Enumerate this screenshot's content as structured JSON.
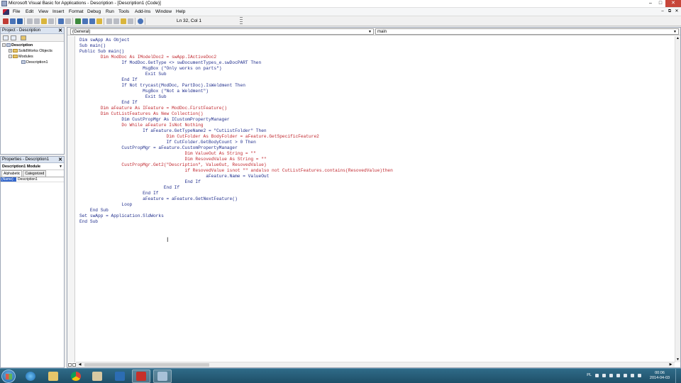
{
  "window": {
    "title": "Microsoft Visual Basic for Applications - Description - [Description1 (Code)]"
  },
  "menu": [
    "File",
    "Edit",
    "View",
    "Insert",
    "Format",
    "Debug",
    "Run",
    "Tools",
    "Add-Ins",
    "Window",
    "Help"
  ],
  "toolbar": {
    "status": "Ln 32, Col 1"
  },
  "project": {
    "title": "Project - Description",
    "tree": {
      "root": "Description",
      "folder1": "SolidWorks Objects",
      "folder2": "Modules",
      "module": "Description1"
    }
  },
  "properties": {
    "title": "Properties - Description1",
    "object": "Description1 Module",
    "tabs": [
      "Alphabetic",
      "Categorized"
    ],
    "name_key": "(Name)",
    "name_value": "Description1"
  },
  "code_window": {
    "object_combo": "(General)",
    "proc_combo": "main",
    "lines": [
      {
        "text": "Dim swApp As Object",
        "err": false
      },
      {
        "text": "Sub main()",
        "err": false
      },
      {
        "text": "Public Sub main()",
        "err": false
      },
      {
        "text": "        Dim ModDoc As IModelDoc2 = swApp.IActiveDoc2",
        "err": true
      },
      {
        "text": "                If ModDoc.GetType <> swDocumentTypes_e.swDocPART Then",
        "err": false
      },
      {
        "text": "                        MsgBox (\"Only works on parts\")",
        "err": false
      },
      {
        "text": "                         Exit Sub",
        "err": false
      },
      {
        "text": "                End If",
        "err": false
      },
      {
        "text": "                If Not trycast(ModDoc, PartDoc).IsWeldment Then",
        "err": false
      },
      {
        "text": "                        MsgBox (\"Not a Weldment\")",
        "err": false
      },
      {
        "text": "                         Exit Sub",
        "err": false
      },
      {
        "text": "                End If",
        "err": false
      },
      {
        "text": "        Dim aFeature As IFeature = ModDoc.FirstFeature()",
        "err": true
      },
      {
        "text": "        Dim CutListFeatures As New Collection()",
        "err": true
      },
      {
        "text": "                Dim CustPropMgr As ICustomPropertyManager",
        "err": false
      },
      {
        "text": "                Do While aFeature IsNot Nothing",
        "err": true
      },
      {
        "text": "                        If aFeature.GetTypeName2 = \"CutListFolder\" Then",
        "err": false
      },
      {
        "text": "                                 Dim CutFolder As BodyFolder = aFeature.GetSpecificFeature2",
        "err": true
      },
      {
        "text": "                                 If CutFolder.GetBodyCount > 0 Then",
        "err": false
      },
      {
        "text": "                CustPropMgr = aFeature.CustomPropertyManager",
        "err": false
      },
      {
        "text": "                                        Dim ValueOut As String = \"\"",
        "err": true
      },
      {
        "text": "                                        Dim ResovedValue As String = \"\"",
        "err": true
      },
      {
        "text": "                CustPropMgr.Get2(\"Description\", ValueOut, ResovedValue)",
        "err": true
      },
      {
        "text": "                                        if ResovedValue isnot \"\" andalso not CutListFeatures.contains(ResovedValue)then",
        "err": true
      },
      {
        "text": "                                                aFeature.Name = ValueOut",
        "err": false
      },
      {
        "text": "                                        End If",
        "err": false
      },
      {
        "text": "                                End If",
        "err": false
      },
      {
        "text": "                        End If",
        "err": false
      },
      {
        "text": "                        aFeature = aFeature.GetNextFeature()",
        "err": false
      },
      {
        "text": "                Loop",
        "err": false
      },
      {
        "text": "    End Sub",
        "err": false
      },
      {
        "text": "Set swApp = Application.SldWorks",
        "err": false
      },
      {
        "text": "End Sub",
        "err": false
      }
    ]
  },
  "taskbar": {
    "lang": "PL",
    "time": "00:06",
    "date": "2014-04-03"
  }
}
